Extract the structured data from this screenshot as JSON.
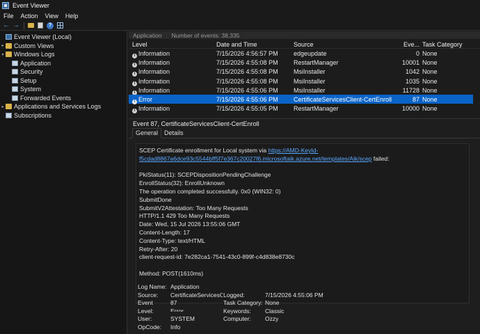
{
  "window": {
    "title": "Event Viewer"
  },
  "menu": [
    "File",
    "Action",
    "View",
    "Help"
  ],
  "toolbar": {
    "icons": [
      "back-arrow-icon",
      "forward-arrow-icon",
      "folder-icon",
      "properties-icon",
      "help-icon",
      "grid-icon"
    ]
  },
  "tree": {
    "root": "Event Viewer (Local)",
    "custom_views": "Custom Views",
    "windows_logs": "Windows Logs",
    "logs": [
      "Application",
      "Security",
      "Setup",
      "System",
      "Forwarded Events"
    ],
    "apps_services": "Applications and Services Logs",
    "subscriptions": "Subscriptions"
  },
  "list": {
    "header_log": "Application",
    "header_count": "Number of events: 38,335",
    "columns": {
      "level": "Level",
      "date": "Date and Time",
      "source": "Source",
      "event_id": "Eve...",
      "task": "Task Category"
    },
    "rows": [
      {
        "level": "Information",
        "date": "7/15/2026 4:56:57 PM",
        "source": "edgeupdate",
        "event_id": "0",
        "task": "None"
      },
      {
        "level": "Information",
        "date": "7/15/2026 4:55:08 PM",
        "source": "RestartManager",
        "event_id": "10001",
        "task": "None"
      },
      {
        "level": "Information",
        "date": "7/15/2026 4:55:08 PM",
        "source": "MsiInstaller",
        "event_id": "1042",
        "task": "None"
      },
      {
        "level": "Information",
        "date": "7/15/2026 4:55:08 PM",
        "source": "MsiInstaller",
        "event_id": "1035",
        "task": "None"
      },
      {
        "level": "Information",
        "date": "7/15/2026 4:55:06 PM",
        "source": "MsiInstaller",
        "event_id": "11728",
        "task": "None"
      },
      {
        "level": "Error",
        "date": "7/15/2026 4:55:06 PM",
        "source": "CertificateServicesClient-CertEnroll",
        "event_id": "87",
        "task": "None"
      },
      {
        "level": "Information",
        "date": "7/15/2026 4:55:05 PM",
        "source": "RestartManager",
        "event_id": "10000",
        "task": "None"
      }
    ],
    "selected_index": 5
  },
  "detail": {
    "title": "Event 87, CertificateServicesClient-CertEnroll",
    "tabs": [
      "General",
      "Details"
    ],
    "description": {
      "line1_prefix": "SCEP Certificate enrollment for Local system via ",
      "link_part1": "https://AMD-KeyId-",
      "link_part2": "f5cdad8867a6dce93c5544bff5f7e367c20027f6.microsoftaik.azure.net/templates/Aik/scep",
      "line2_suffix": " failed:",
      "lines": [
        "",
        "PkiStatus(11): SCEPDispositionPendingChallenge",
        "EnrollStatus(32): EnrollUnknown",
        "The operation completed successfully. 0x0 (WIN32: 0)",
        "SubmitDone",
        "SubmitV2Attestation: Too Many Requests",
        "HTTP/1.1 429 Too Many Requests",
        "Date: Wed, 15 Jul 2026 13:55:06 GMT",
        "Content-Length: 17",
        "Content-Type: text/HTML",
        "Retry-After: 20",
        "client-request-id: 7e282ca1-7541-43c0-899f-c4d838e8730c",
        "",
        "Method: POST(1610ms)"
      ]
    },
    "props": {
      "log_name_label": "Log Name:",
      "log_name": "Application",
      "source_label": "Source:",
      "source": "CertificateServicesC",
      "logged_label": "Logged:",
      "logged": "7/15/2026 4:55:06 PM",
      "event_label": "Event",
      "event": "87",
      "task_label": "Task Category:",
      "task": "None",
      "level_label": "Level:",
      "level": "Error",
      "keywords_label": "Keywords:",
      "keywords": "Classic",
      "user_label": "User:",
      "user": "SYSTEM",
      "computer_label": "Computer:",
      "computer": "Ozzy",
      "opcode_label": "OpCode:",
      "opcode": "Info"
    }
  },
  "colors": {
    "selection": "#0a64c8",
    "link": "#5aa7ff",
    "background": "#1e1e1e"
  }
}
